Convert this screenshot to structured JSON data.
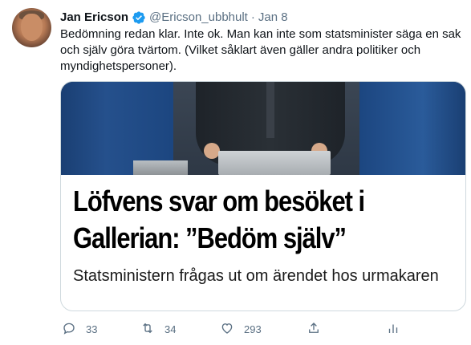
{
  "tweet": {
    "author_name": "Jan Ericson",
    "handle": "@Ericson_ubbhult",
    "separator": "·",
    "date": "Jan 8",
    "text": "Bedömning redan klar. Inte ok. Man kan inte som statsminister säga en sak och själv göra tvärtom. (Vilket såklart även gäller andra politiker och myndighetspersoner)."
  },
  "card": {
    "headline_line1": "Löfvens svar om besöket i",
    "headline_line2": "Gallerian: ”Bedöm själv”",
    "subtitle": "Statsministern frågas ut om ärendet hos urmakaren"
  },
  "actions": {
    "reply_count": "33",
    "retweet_count": "34",
    "like_count": "293"
  },
  "icons": {
    "verified": "verified-badge-icon",
    "reply": "reply-icon",
    "retweet": "retweet-icon",
    "like": "heart-icon",
    "share": "share-icon",
    "analytics": "analytics-icon"
  },
  "colors": {
    "verified_blue": "#1d9bf0",
    "secondary_text": "#5b7083",
    "primary_text": "#0f1419",
    "card_border": "#cfd9de"
  }
}
